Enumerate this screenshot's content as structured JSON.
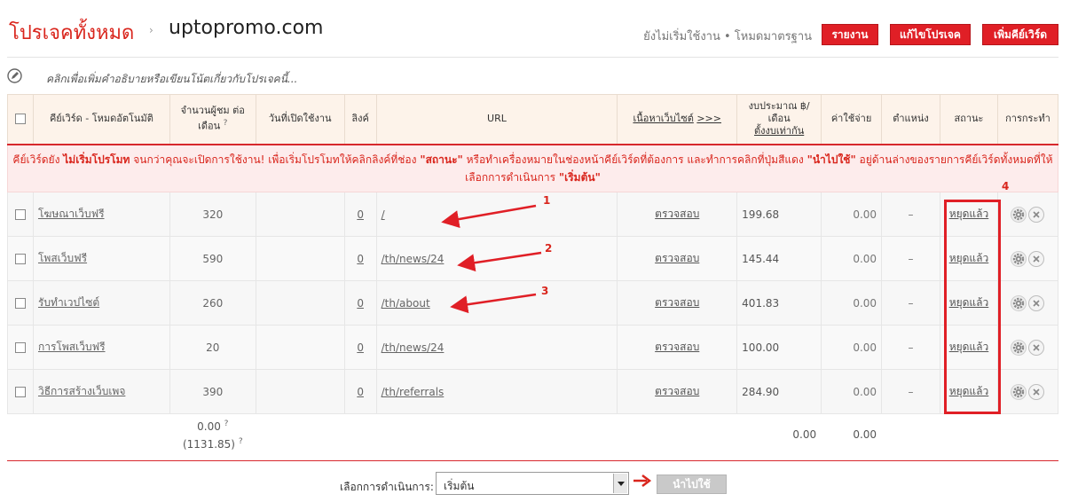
{
  "header": {
    "breadcrumb_root": "โปรเจคทั้งหมด",
    "separator": "›",
    "site": "uptopromo.com",
    "status": "ยังไม่เริ่มใช้งาน • โหมดมาตรฐาน",
    "buttons": {
      "report": "รายงาน",
      "edit_project": "แก้ไขโปรเจค",
      "add_keyword": "เพิ่มคีย์เวิร์ด"
    }
  },
  "description_placeholder": "คลิกเพื่อเพิ่มคำอธิบายหรือเขียนโน้ตเกี่ยวกับโปรเจคนี้...",
  "table": {
    "headers": {
      "keyword": "คีย์เวิร์ด - โหมดอัตโนมัติ",
      "monthly_visitors": "จำนวนผู้ชม ต่อเดือน",
      "open_date": "วันที่เปิดใช้งาน",
      "links": "ลิงค์",
      "url": "URL",
      "site_content": "เนื้อหาเว็บไซต์",
      "site_content_more": ">>>",
      "budget_line1": "งบประมาณ ฿/",
      "budget_line2": "เดือน",
      "budget_set": "ตั้งงบเท่ากัน",
      "cost": "ค่าใช้จ่าย",
      "position": "ตำแหน่ง",
      "status": "สถานะ",
      "actions": "การกระทำ",
      "q_mark": "?"
    },
    "warning": {
      "part1": "คีย์เวิร์ดยัง ",
      "bold1": "ไม่เริ่มโปรโมท",
      "part2": " จนกว่าคุณจะเปิดการใช้งาน! เพื่อเริ่มโปรโมทให้คลิกลิงค์ที่ช่อง ",
      "bold2": "\"สถานะ\"",
      "part3": " หรือทำเครื่องหมายในช่องหน้าคีย์เวิร์ดที่ต้องการ และทำการคลิกที่ปุ่มสีแดง ",
      "bold3": "\"นำไปใช้\"",
      "part4": " อยู่ด้านล่างของรายการคีย์เวิร์ดทั้งหมดที่ให้เลือกการดำเนินการ ",
      "bold4": "\"เริ่มต้น\""
    },
    "rows": [
      {
        "keyword": "โฆษณาเว็บฟรี",
        "visitors": "320",
        "links": "0",
        "url": "/",
        "verify": "ตรวจสอบ",
        "budget": "199.68",
        "cost": "0.00",
        "position": "–",
        "status": "หยุดแล้ว"
      },
      {
        "keyword": "โพสเว็บฟรี",
        "visitors": "590",
        "links": "0",
        "url": "/th/news/24",
        "verify": "ตรวจสอบ",
        "budget": "145.44",
        "cost": "0.00",
        "position": "–",
        "status": "หยุดแล้ว"
      },
      {
        "keyword": "รับทำเวปไซต์",
        "visitors": "260",
        "links": "0",
        "url": "/th/about",
        "verify": "ตรวจสอบ",
        "budget": "401.83",
        "cost": "0.00",
        "position": "–",
        "status": "หยุดแล้ว"
      },
      {
        "keyword": "การโพสเว็บฟรี",
        "visitors": "20",
        "links": "0",
        "url": "/th/news/24",
        "verify": "ตรวจสอบ",
        "budget": "100.00",
        "cost": "0.00",
        "position": "–",
        "status": "หยุดแล้ว"
      },
      {
        "keyword": "วิธีการสร้างเว็บเพจ",
        "visitors": "390",
        "links": "0",
        "url": "/th/referrals",
        "verify": "ตรวจสอบ",
        "budget": "284.90",
        "cost": "0.00",
        "position": "–",
        "status": "หยุดแล้ว"
      }
    ],
    "totals": {
      "visitors": "0.00",
      "visitors_sub": "(1131.85)",
      "budget": "0.00",
      "cost": "0.00",
      "q": "?"
    }
  },
  "footer": {
    "action_label": "เลือกการดำเนินการ:",
    "action_value": "เริ่มต้น",
    "apply": "นำไปใช้"
  },
  "annotations": [
    "1",
    "2",
    "3",
    "4"
  ],
  "colors": {
    "accent": "#e01f26",
    "header_bg": "#fdf3ea",
    "warning_bg": "#fdecec"
  }
}
